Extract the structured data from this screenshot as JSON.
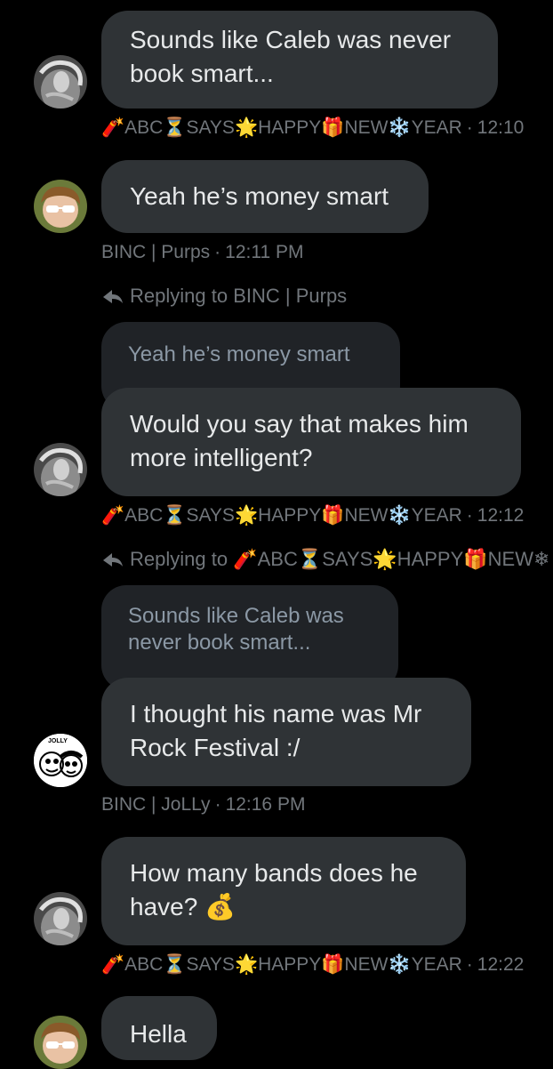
{
  "messages": [
    {
      "text": "Sounds like Caleb was never\nbook smart...",
      "sender": "🧨ABC⏳SAYS🌟HAPPY🎁NEW❄️YEAR",
      "time": "12:10"
    },
    {
      "text": "Yeah he’s money smart",
      "sender": "BINC | Purps",
      "time": "12:11 PM"
    },
    {
      "reply_prefix": "Replying to",
      "reply_to": "BINC | Purps",
      "quoted": "Yeah he’s money smart",
      "text": "Would you say that makes him\nmore intelligent?",
      "sender": "🧨ABC⏳SAYS🌟HAPPY🎁NEW❄️YEAR",
      "time": "12:12"
    },
    {
      "reply_prefix": "Replying to",
      "reply_to": "🧨ABC⏳SAYS🌟HAPPY🎁NEW❄",
      "quoted": "Sounds like Caleb was\nnever book smart...",
      "text": "I thought his name was Mr\nRock Festival :/",
      "sender": "BINC | JoLLy",
      "time": "12:16 PM"
    },
    {
      "text": "How many bands does he\nhave? 💰",
      "sender": "🧨ABC⏳SAYS🌟HAPPY🎁NEW❄️YEAR",
      "time": "12:22"
    },
    {
      "text": "Hella"
    }
  ],
  "meta": {
    "separator": "·"
  },
  "colors": {
    "background": "#000000",
    "bubble": "#2f3336",
    "quoted_bubble": "#202327",
    "muted_text": "#71767b"
  },
  "avatar_labels": {
    "jolly": "JOLLY"
  }
}
